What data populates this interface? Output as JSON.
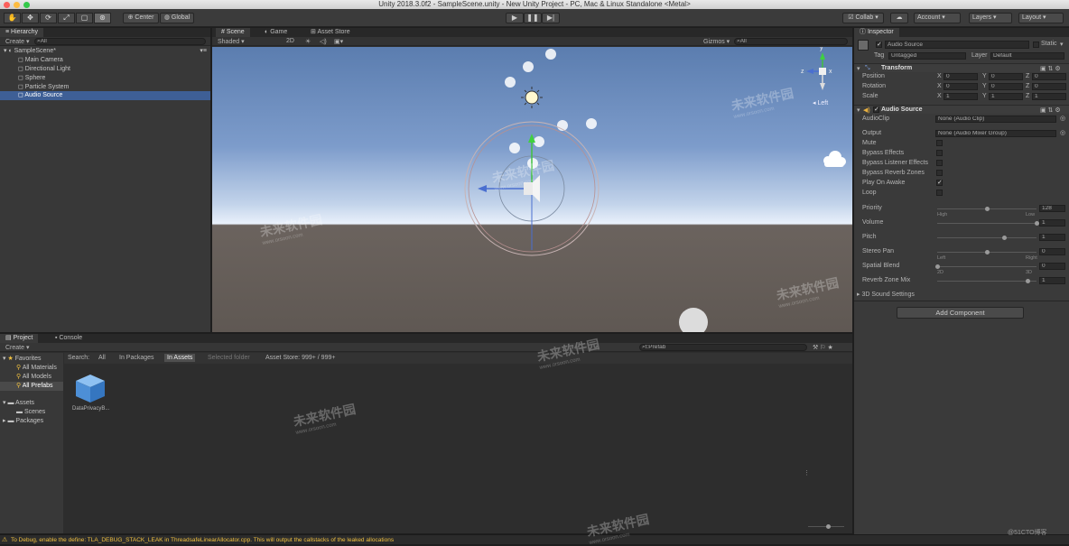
{
  "window": {
    "title": "Unity 2018.3.0f2 - SampleScene.unity - New Unity Project - PC, Mac & Linux Standalone <Metal>"
  },
  "toolbar": {
    "pivot": "Center",
    "space": "Global",
    "collab": "Collab",
    "account": "Account",
    "layers": "Layers",
    "layout": "Layout"
  },
  "hierarchy": {
    "tab": "Hierarchy",
    "create": "Create",
    "search": "All",
    "scene": "SampleScene*",
    "items": [
      "Main Camera",
      "Directional Light",
      "Sphere",
      "Particle System",
      "Audio Source"
    ]
  },
  "scene": {
    "tabs": [
      "Scene",
      "Game",
      "Asset Store"
    ],
    "shading": "Shaded",
    "mode2d": "2D",
    "gizmos": "Gizmos",
    "search": "All",
    "orientation": "Left",
    "axes": {
      "x": "x",
      "y": "y",
      "z": "z"
    }
  },
  "inspector": {
    "tab": "Inspector",
    "object_name": "Audio Source",
    "static": "Static",
    "tag_label": "Tag",
    "tag_value": "Untagged",
    "layer_label": "Layer",
    "layer_value": "Default",
    "transform": {
      "title": "Transform",
      "rows": [
        {
          "label": "Position",
          "x": "0",
          "y": "0",
          "z": "0"
        },
        {
          "label": "Rotation",
          "x": "0",
          "y": "0",
          "z": "0"
        },
        {
          "label": "Scale",
          "x": "1",
          "y": "1",
          "z": "1"
        }
      ],
      "axis_x": "X",
      "axis_y": "Y",
      "axis_z": "Z"
    },
    "audio": {
      "title": "Audio Source",
      "audioclip_label": "AudioClip",
      "audioclip_value": "None (Audio Clip)",
      "output_label": "Output",
      "output_value": "None (Audio Mixer Group)",
      "toggles": [
        {
          "label": "Mute",
          "checked": false
        },
        {
          "label": "Bypass Effects",
          "checked": false
        },
        {
          "label": "Bypass Listener Effects",
          "checked": false
        },
        {
          "label": "Bypass Reverb Zones",
          "checked": false
        },
        {
          "label": "Play On Awake",
          "checked": true
        },
        {
          "label": "Loop",
          "checked": false
        }
      ],
      "sliders": [
        {
          "label": "Priority",
          "value": "128",
          "level": 0.5,
          "min_label": "High",
          "max_label": "Low"
        },
        {
          "label": "Volume",
          "value": "1",
          "level": 1.0,
          "min_label": "",
          "max_label": ""
        },
        {
          "label": "Pitch",
          "value": "1",
          "level": 0.67,
          "min_label": "",
          "max_label": ""
        },
        {
          "label": "Stereo Pan",
          "value": "0",
          "level": 0.5,
          "min_label": "Left",
          "max_label": "Right"
        },
        {
          "label": "Spatial Blend",
          "value": "0",
          "level": 0.0,
          "min_label": "2D",
          "max_label": "3D"
        },
        {
          "label": "Reverb Zone Mix",
          "value": "1",
          "level": 0.91,
          "min_label": "",
          "max_label": ""
        }
      ],
      "sound_settings": "3D Sound Settings"
    },
    "add_component": "Add Component"
  },
  "project": {
    "tabs": [
      "Project",
      "Console"
    ],
    "create": "Create",
    "search_value": "t:Prefab",
    "filter": {
      "search_label": "Search:",
      "all": "All",
      "in_packages": "In Packages",
      "in_assets": "In Assets",
      "selected_folder": "Selected folder",
      "asset_store": "Asset Store: 999+ / 999+"
    },
    "favorites": {
      "title": "Favorites",
      "items": [
        "All Materials",
        "All Models",
        "All Prefabs"
      ]
    },
    "assets": {
      "title": "Assets",
      "items": [
        "Scenes"
      ]
    },
    "packages": "Packages",
    "asset_item": "DataPrivacyB..."
  },
  "status": {
    "message": "To Debug, enable the define: TLA_DEBUG_STACK_LEAK in ThreadsafeLinearAllocator.cpp. This will output the callstacks of the leaked allocations"
  },
  "watermarks": {
    "brand": "未来软件园",
    "url": "www.orsoon.com",
    "corner": "@51CTO博客"
  },
  "colors": {
    "selection": "#3e5f96",
    "sky_top": "#5d7fb2",
    "sky_horizon": "#e9f0fb",
    "ground": "#6b625d",
    "warning": "#f0c040"
  }
}
